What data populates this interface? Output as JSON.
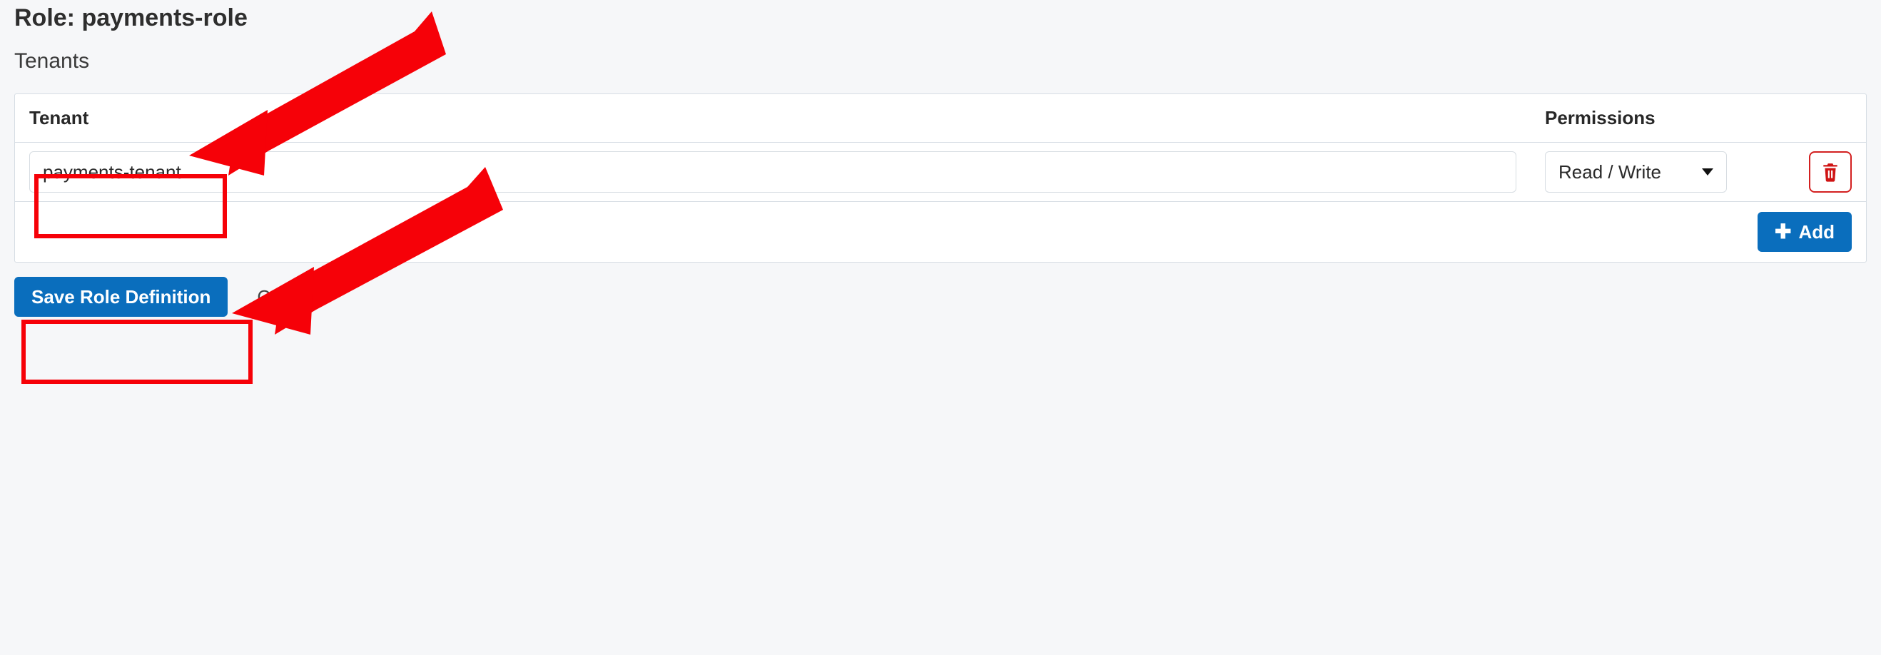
{
  "page": {
    "title": "Role: payments-role",
    "subtitle": "Tenants"
  },
  "table": {
    "headers": {
      "tenant": "Tenant",
      "permissions": "Permissions"
    },
    "rows": [
      {
        "tenant_value": "payments-tenant",
        "permission_label": "Read / Write"
      }
    ]
  },
  "buttons": {
    "add": "Add",
    "save": "Save Role Definition",
    "cancel": "Cancel"
  },
  "annotations": {
    "highlight_tenant_input": true,
    "highlight_save_button": true,
    "arrow_to_tenant": true,
    "arrow_to_save": true,
    "color": "#f60108"
  }
}
